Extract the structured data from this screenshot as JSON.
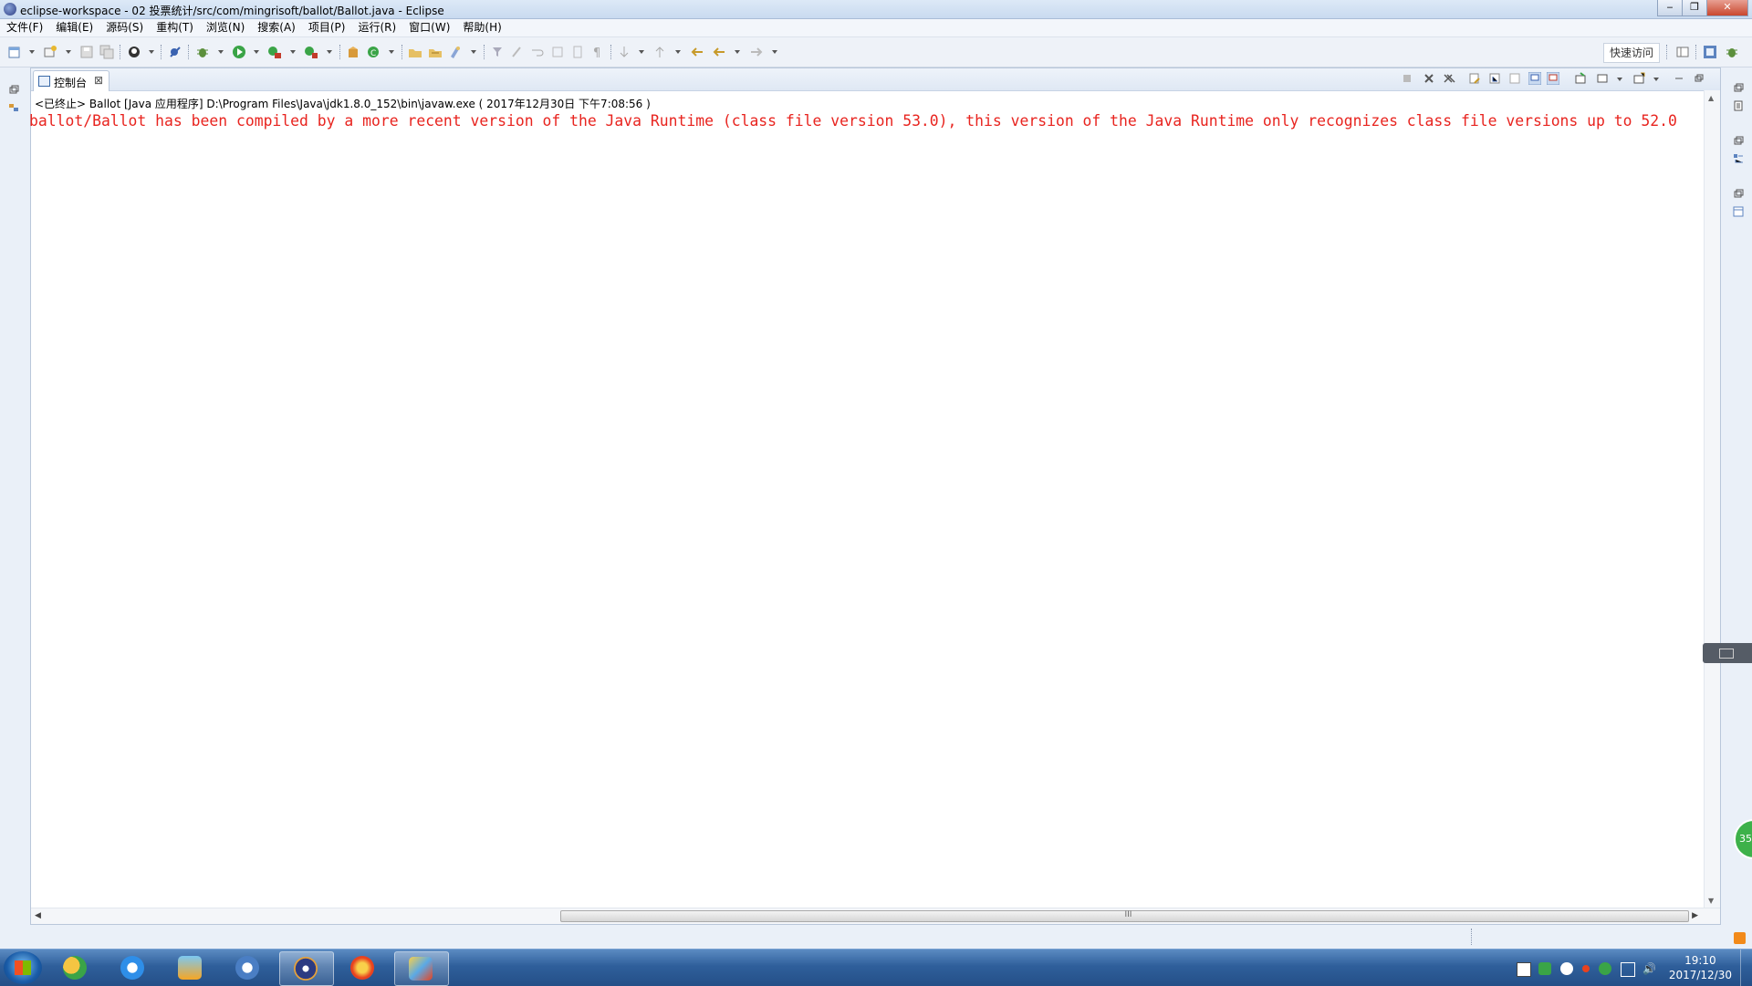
{
  "window": {
    "title": "eclipse-workspace - 02  投票统计/src/com/mingrisoft/ballot/Ballot.java - Eclipse",
    "minimize": "‒",
    "maximize": "❐",
    "close": "✕"
  },
  "menu": {
    "items": [
      {
        "label": "文件(F)"
      },
      {
        "label": "编辑(E)"
      },
      {
        "label": "源码(S)"
      },
      {
        "label": "重构(T)"
      },
      {
        "label": "浏览(N)"
      },
      {
        "label": "搜索(A)"
      },
      {
        "label": "项目(P)"
      },
      {
        "label": "运行(R)"
      },
      {
        "label": "窗口(W)"
      },
      {
        "label": "帮助(H)"
      }
    ]
  },
  "toolbar": {
    "quick_access": "快速访问"
  },
  "console": {
    "tab_label": "控制台",
    "tab_close": "⊠",
    "status": "<已终止> Ballot [Java 应用程序] D:\\Program Files\\Java\\jdk1.8.0_152\\bin\\javaw.exe ( 2017年12月30日 下午7:08:56 )",
    "error": "ballot/Ballot has been compiled by a more recent version of the Java Runtime (class file version 53.0), this version of the Java Runtime only recognizes class file versions up to 52.0",
    "scroll_grip": "III"
  },
  "taskbar": {
    "time": "19:10",
    "date": "2017/12/30",
    "badge": "35"
  },
  "colors": {
    "error_text": "#e8241f",
    "taskbar": "#2f5f9b"
  }
}
